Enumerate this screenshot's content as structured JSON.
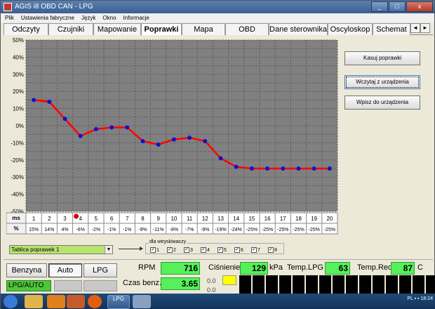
{
  "window": {
    "title": "AGIS i8 OBD CAN - LPG",
    "controls": [
      "_",
      "□",
      "x"
    ]
  },
  "menu": [
    "Plik",
    "Ustawienia fabryczne",
    "Język",
    "Okno",
    "Informacje"
  ],
  "tabs": [
    "Odczyty",
    "Czujniki",
    "Mapowanie",
    "Poprawki",
    "Mapa",
    "OBD",
    "Dane sterownika",
    "Oscyloskop",
    "Schemat"
  ],
  "active_tab": "Poprawki",
  "tab_arrows": [
    "◄",
    "►"
  ],
  "chart_data": {
    "type": "line",
    "ylim": [
      -50,
      50
    ],
    "y_ticks": [
      "50%",
      "40%",
      "30%",
      "20%",
      "10%",
      "0%",
      "-10%",
      "-20%",
      "-30%",
      "-40%",
      "-50%"
    ],
    "x_header": "ms",
    "value_header": "%",
    "categories": [
      "1",
      "2",
      "3",
      "4",
      "5",
      "6",
      "7",
      "8",
      "9",
      "10",
      "11",
      "12",
      "13",
      "14",
      "15",
      "16",
      "17",
      "18",
      "19",
      "20"
    ],
    "values": [
      15,
      14,
      4,
      -6,
      -2,
      -1,
      -1,
      -9,
      -11,
      -8,
      -7,
      -9,
      -19,
      -24,
      -25,
      -25,
      -25,
      -25,
      -25,
      -25
    ],
    "value_labels": [
      "15%",
      "14%",
      "4%",
      "-6%",
      "-2%",
      "-1%",
      "-1%",
      "-9%",
      "-11%",
      "-8%",
      "-7%",
      "-9%",
      "-19%",
      "-24%",
      "-25%",
      "-25%",
      "-25%",
      "-25%",
      "-25%",
      "-25%"
    ],
    "marker_index": 3,
    "colors": {
      "background": "#808080",
      "line": "#ff0000",
      "points": "#1010d0",
      "marker": "#cc0000"
    },
    "grid": true
  },
  "right_buttons": {
    "clear": "Kasuj poprawki",
    "load": "Wczytaj z urządzenia",
    "write": "Wpisz do urządzenia"
  },
  "table_select": "Tablica poprawek 1",
  "injectors": {
    "legend": "dla wtryskiwaczy",
    "items": [
      "1",
      "2",
      "3",
      "4",
      "5",
      "6",
      "7",
      "8"
    ],
    "checked": true
  },
  "fuel_buttons": {
    "petrol": "Benzyna",
    "auto": "Auto",
    "lpg": "LPG"
  },
  "status": "LPG/AUTO",
  "readings": {
    "rpm_label": "RPM",
    "rpm_value": "716",
    "pressure_label": "Ciśnienie",
    "pressure_value": "129",
    "pressure_unit": "kPa",
    "temp_lpg_label": "Temp.LPG",
    "temp_lpg_value": "63",
    "temp_red_label": "Temp.Red",
    "temp_red_value": "87",
    "temp_unit": "C",
    "petrol_time_label": "Czas benz.",
    "petrol_time_value": "3.65",
    "small_value_1": "0.0",
    "small_value_2": "0.0"
  },
  "taskbar": {
    "active_app": "LPG",
    "tray": "PL  ▪ ▪  18:24"
  }
}
